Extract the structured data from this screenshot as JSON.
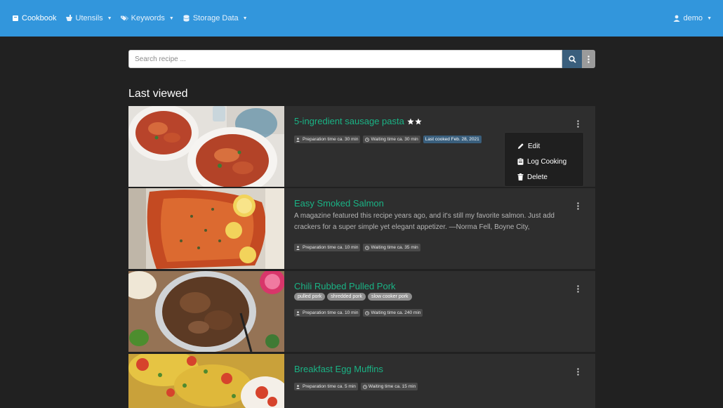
{
  "navbar": {
    "brand": "Cookbook",
    "items": [
      {
        "label": "Utensils",
        "icon": "blender-icon"
      },
      {
        "label": "Keywords",
        "icon": "tags-icon"
      },
      {
        "label": "Storage Data",
        "icon": "database-icon"
      }
    ],
    "user": "demo"
  },
  "search": {
    "placeholder": "Search recipe ..."
  },
  "section_title": "Last viewed",
  "recipes": [
    {
      "title": "5-ingredient sausage pasta",
      "rating_stars": 2,
      "description": "",
      "keywords": [],
      "prep": "Preparation time ca. 30 min",
      "wait": "Waiting time ca. 30 min",
      "last_cooked": "Last cooked Feb. 28, 2021"
    },
    {
      "title": "Easy Smoked Salmon",
      "description": "A magazine featured this recipe years ago, and it's still my favorite salmon. Just add crackers for a super simple yet elegant appetizer. —Norma Fell, Boyne City,",
      "keywords": [],
      "prep": "Preparation time ca. 10 min",
      "wait": "Waiting time ca. 35 min"
    },
    {
      "title": "Chili Rubbed Pulled Pork",
      "description": "",
      "keywords": [
        "pulled pork",
        "shredded pork",
        "slow cooker pork"
      ],
      "prep": "Preparation time ca. 10 min",
      "wait": "Waiting time ca. 240 min"
    },
    {
      "title": "Breakfast Egg Muffins",
      "description": "",
      "keywords": [],
      "prep": "Preparation time ca. 5 min",
      "wait": "Waiting time ca. 15 min"
    }
  ],
  "dropdown": {
    "edit": "Edit",
    "log": "Log Cooking",
    "delete": "Delete"
  },
  "colors": {
    "navbar": "#3296dc",
    "title_green": "#1ab385",
    "background": "#212121",
    "card": "#2e2e2e"
  }
}
